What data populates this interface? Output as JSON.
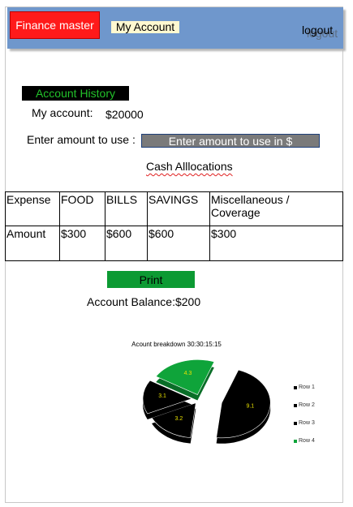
{
  "header": {
    "brand": "Finance master",
    "my_account": "My Account",
    "logout": "logout",
    "logout_ghost": "logout"
  },
  "account": {
    "history_button": "Account History",
    "my_account_label": "My account:",
    "my_account_value": "$20000",
    "amount_label": "Enter amount to use  :",
    "amount_placeholder": "Enter amount to use in $",
    "cash_allocations": "Cash Alllocations"
  },
  "table": {
    "headers": [
      "Expense",
      "FOOD",
      "BILLS",
      "SAVINGS",
      "Miscellaneous / Coverage"
    ],
    "row": [
      "Amount",
      "$300",
      "$600",
      "$600",
      "$300"
    ]
  },
  "actions": {
    "print": "Print",
    "balance": "Account Balance:$200"
  },
  "chart_data": {
    "type": "pie",
    "title": "Acount breakdown 30:30:15:15",
    "categories": [
      "Row 1",
      "Row 2",
      "Row 3",
      "Row 4"
    ],
    "values": [
      9.1,
      3.2,
      3.1,
      4.3
    ],
    "labels": [
      "9.1",
      "3.2",
      "3.1",
      "4.3"
    ],
    "colors": [
      "#000000",
      "#000000",
      "#000000",
      "#0fa43a"
    ],
    "legend_position": "right"
  }
}
